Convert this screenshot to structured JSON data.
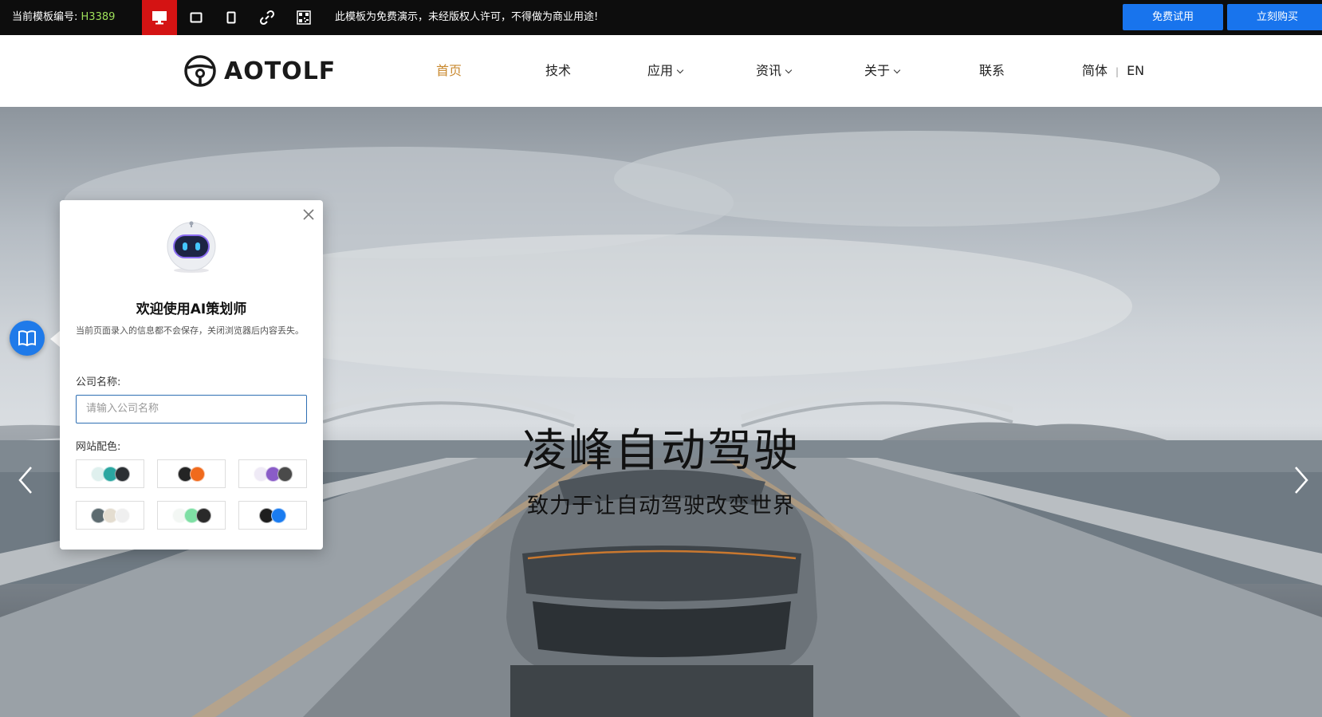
{
  "topbar": {
    "template_label": "当前模板编号:",
    "template_code": "H3389",
    "notice": "此模板为免费演示，未经版权人许可，不得做为商业用途!",
    "free_trial": "免费试用",
    "buy_now": "立刻购买",
    "device_icons": [
      "desktop-icon",
      "tablet-landscape-icon",
      "tablet-portrait-icon",
      "link-icon",
      "qrcode-icon"
    ]
  },
  "header": {
    "logo_text": "AOTOLF",
    "nav": [
      {
        "label": "首页",
        "active": true
      },
      {
        "label": "技术"
      },
      {
        "label": "应用",
        "dropdown": true
      },
      {
        "label": "资讯",
        "dropdown": true
      },
      {
        "label": "关于",
        "dropdown": true
      },
      {
        "label": "联系"
      }
    ],
    "lang_cn": "简体",
    "lang_sep": "|",
    "lang_en": "EN"
  },
  "hero": {
    "title": "凌峰自动驾驶",
    "subtitle": "致力于让自动驾驶改变世界"
  },
  "ai_panel": {
    "title": "欢迎使用AI策划师",
    "description": "当前页面录入的信息都不会保存，关闭浏览器后内容丢失。",
    "company_label": "公司名称:",
    "company_placeholder": "请输入公司名称",
    "color_label": "网站配色:",
    "palettes": [
      [
        "#dff0ee",
        "#2aa6a0",
        "#2b2f33"
      ],
      [
        "#242424",
        "#f06a1c"
      ],
      [
        "#efeaf6",
        "#8a5cc7",
        "#4a4a4a"
      ],
      [
        "#5d6b70",
        "#e4ddd0",
        "#efefef"
      ],
      [
        "#f3f7f4",
        "#7edfa4",
        "#2a2a2a"
      ],
      [
        "#1e1e1e",
        "#1b7cf0"
      ]
    ]
  },
  "colors": {
    "accent": "#1874ed",
    "nav_active": "#c9892f",
    "demo_active": "#d41313"
  }
}
